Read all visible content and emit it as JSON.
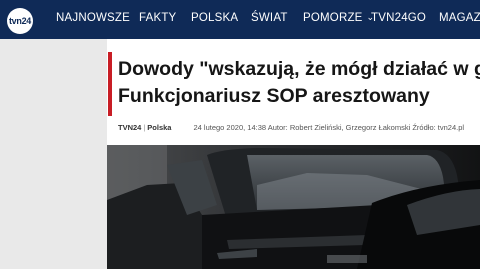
{
  "logo": {
    "text": "tvn24"
  },
  "nav": [
    {
      "label": "NAJNOWSZE"
    },
    {
      "label": "FAKTY"
    },
    {
      "label": "POLSKA"
    },
    {
      "label": "ŚWIAT"
    },
    {
      "label": "POMORZE",
      "has_dropdown": true
    },
    {
      "label": "TVN24GO"
    },
    {
      "label": "MAGAZY"
    }
  ],
  "article": {
    "title_line1": "Dowody \"wskazują, że mógł działać w g",
    "title_line2": "Funkcjonariusz SOP aresztowany",
    "source": "TVN24",
    "section": "Polska",
    "meta": "24 lutego 2020, 14:38 Autor: Robert Zieliński, Grzegorz Łakomski Źródło: tvn24.pl"
  },
  "colors": {
    "nav_bg": "#0f2a57",
    "accent": "#c81d25",
    "title": "#161616"
  }
}
